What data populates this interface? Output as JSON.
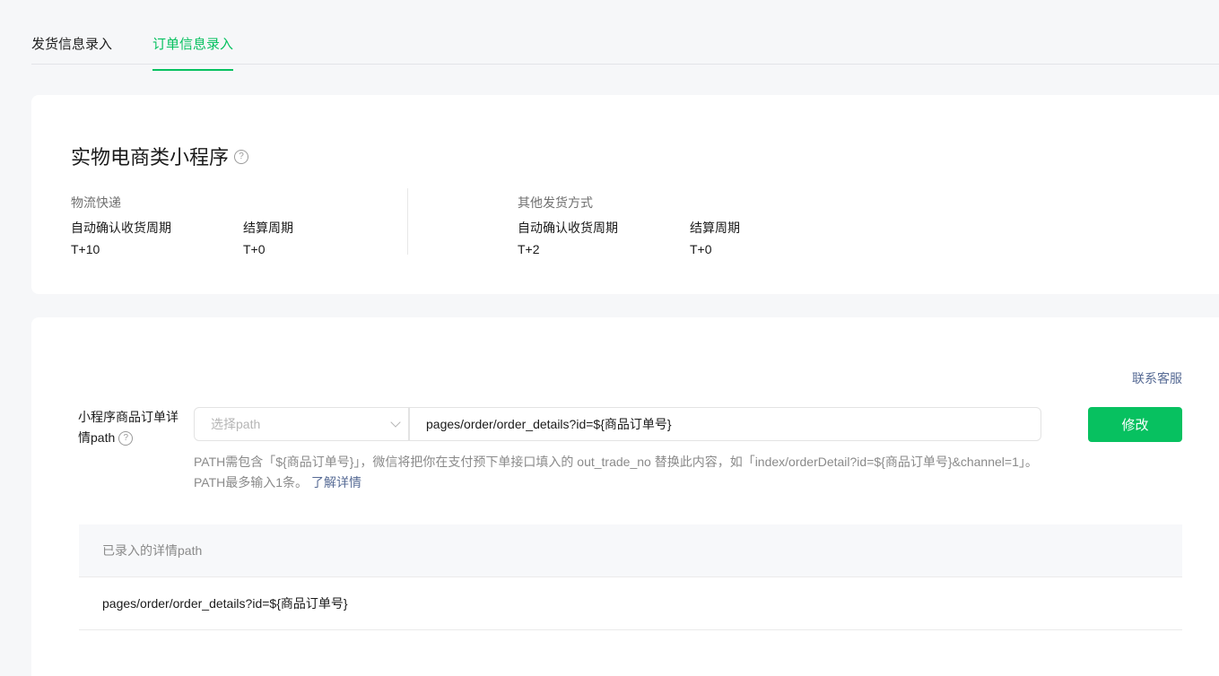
{
  "tabs": [
    {
      "label": "发货信息录入",
      "active": false
    },
    {
      "label": "订单信息录入",
      "active": true
    }
  ],
  "summary": {
    "title": "实物电商类小程序",
    "sections": [
      {
        "label": "物流快递",
        "items": [
          {
            "key": "自动确认收货周期",
            "value": "T+10"
          },
          {
            "key": "结算周期",
            "value": "T+0"
          }
        ]
      },
      {
        "label": "其他发货方式",
        "items": [
          {
            "key": "自动确认收货周期",
            "value": "T+2"
          },
          {
            "key": "结算周期",
            "value": "T+0"
          }
        ]
      }
    ]
  },
  "config": {
    "contact_label": "联系客服",
    "field_label": "小程序商品订单详情path",
    "select_placeholder": "选择path",
    "path_value": "pages/order/order_details?id=${商品订单号}",
    "modify_label": "修改",
    "hint_text": "PATH需包含「${商品订单号}」，微信将把你在支付预下单接口填入的 out_trade_no 替换此内容，如「index/orderDetail?id=${商品订单号}&channel=1」。PATH最多输入1条。",
    "hint_link": "了解详情"
  },
  "table": {
    "header": "已录入的详情path",
    "rows": [
      "pages/order/order_details?id=${商品订单号}"
    ]
  },
  "colors": {
    "accent": "#07c160",
    "link": "#576b95"
  }
}
